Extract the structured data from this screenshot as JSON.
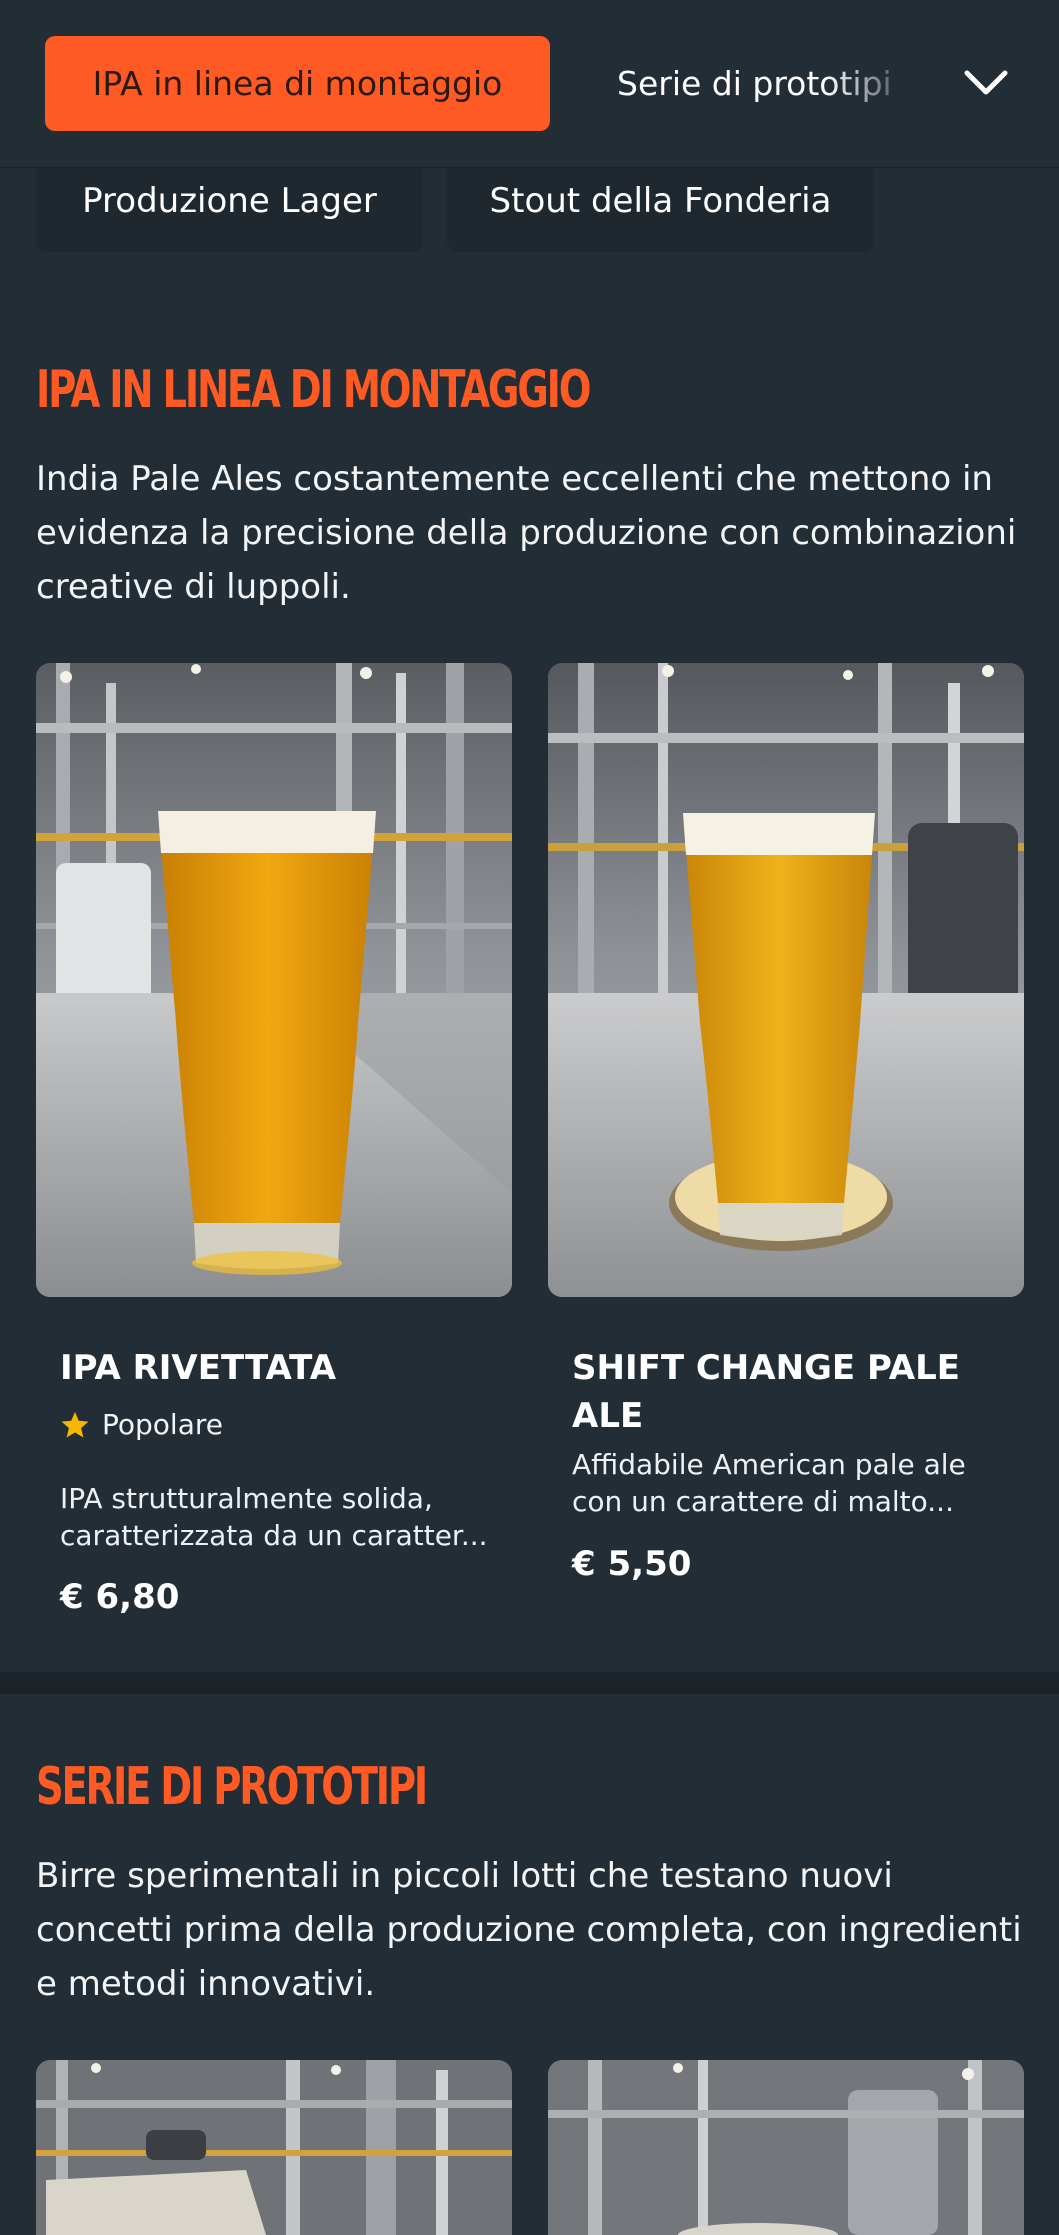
{
  "nav": {
    "active_tab": "IPA in linea di montaggio",
    "next_tab": "Serie di prototipi",
    "chips": [
      "Produzione Lager",
      "Stout della Fonderia"
    ],
    "expand_icon": "chevron-down-icon"
  },
  "sections": [
    {
      "title": "IPA IN LINEA DI MONTAGGIO",
      "description": "India Pale Ales costantemente eccellenti che mettono in evidenza la precisione della produzione con combinazioni creative di luppoli.",
      "products": [
        {
          "name": "IPA RIVETTATA",
          "badge": "Popolare",
          "badge_icon": "star-icon",
          "description": "IPA strutturalmente solida, caratterizzata da un caratter...",
          "price": "€ 6,80"
        },
        {
          "name": "SHIFT CHANGE PALE ALE",
          "description": "Affidabile American pale ale con un carattere di malto...",
          "price": "€ 5,50"
        }
      ]
    },
    {
      "title": "SERIE DI PROTOTIPI",
      "description": "Birre sperimentali in piccoli lotti che testano nuovi concetti prima della produzione completa, con ingredienti e metodi innovativi."
    }
  ],
  "colors": {
    "accent": "#ff5a24",
    "background": "#232d35",
    "chip": "#1f282f",
    "star": "#f5b800"
  }
}
